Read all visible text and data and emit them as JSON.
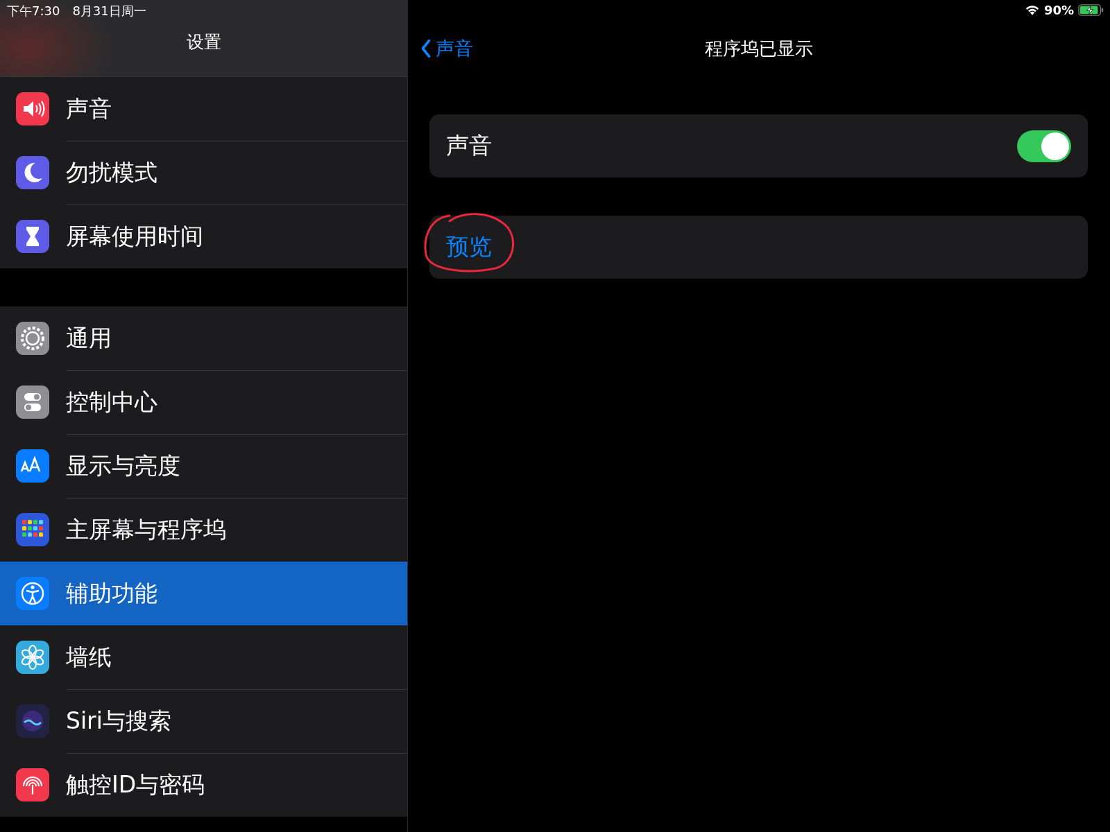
{
  "status_bar": {
    "time": "下午7:30",
    "date": "8月31日周一",
    "battery": "90%"
  },
  "sidebar": {
    "title": "设置",
    "groups": [
      {
        "items": [
          {
            "label": "声音",
            "color": "#f2384c",
            "selected": false
          },
          {
            "label": "勿扰模式",
            "color": "#5e5ce6",
            "selected": false
          },
          {
            "label": "屏幕使用时间",
            "color": "#5e5ce6",
            "selected": false
          }
        ]
      },
      {
        "items": [
          {
            "label": "通用",
            "color": "#8e8e93",
            "selected": false
          },
          {
            "label": "控制中心",
            "color": "#8e8e93",
            "selected": false
          },
          {
            "label": "显示与亮度",
            "color": "#0a7cff",
            "selected": false
          },
          {
            "label": "主屏幕与程序坞",
            "color": "#2f57d9",
            "selected": false
          },
          {
            "label": "辅助功能",
            "color": "#0a7cff",
            "selected": true
          },
          {
            "label": "墙纸",
            "color": "#35aadc",
            "selected": false
          },
          {
            "label": "Siri与搜索",
            "color": "#222244",
            "selected": false
          },
          {
            "label": "触控ID与密码",
            "color": "#f2384c",
            "selected": false
          }
        ]
      }
    ]
  },
  "detail": {
    "back": "声音",
    "title": "程序坞已显示",
    "rows": [
      {
        "kind": "toggle",
        "label": "声音",
        "on": true
      },
      {
        "kind": "link",
        "label": "预览",
        "annotated": true
      }
    ]
  }
}
